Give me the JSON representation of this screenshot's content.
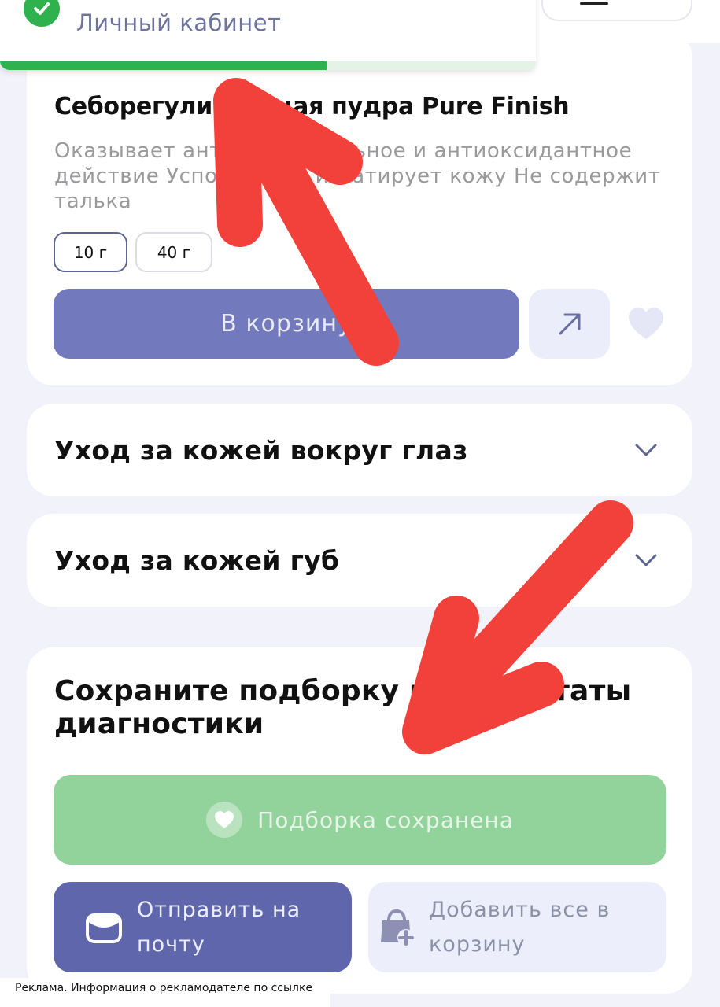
{
  "toast": {
    "text": "Личный кабинет",
    "progress": 0.61,
    "success_color": "#2fb24d"
  },
  "product": {
    "title": "Себорегулирующая пудра Pure Finish",
    "description": "Оказывает антибактериальное и антиоксидантное действие Успокаивает и матирует кожу Не содержит талька",
    "sizes": [
      {
        "label": "10 г",
        "selected": true
      },
      {
        "label": "40 г",
        "selected": false
      }
    ],
    "cart_button": "В корзину",
    "share_icon": "arrow-up-right-icon",
    "favorite_icon": "heart-icon"
  },
  "accordions": [
    {
      "title": "Уход за кожей вокруг глаз",
      "icon": "chevron-down-icon"
    },
    {
      "title": "Уход за кожей губ",
      "icon": "chevron-down-icon"
    }
  ],
  "save_section": {
    "title": "Сохраните подборку и результаты диагностики",
    "saved_button": "Подборка сохранена",
    "mail_button": "Отправить на почту",
    "add_all_button": "Добавить все в корзину"
  },
  "ad_notice": "Реклама. Информация о рекламодателе по ссылке",
  "colors": {
    "accent": "#7279bd",
    "accent_dark": "#5f66ac",
    "saved_green": "#92d29b",
    "annotation_red": "#f2413a"
  }
}
